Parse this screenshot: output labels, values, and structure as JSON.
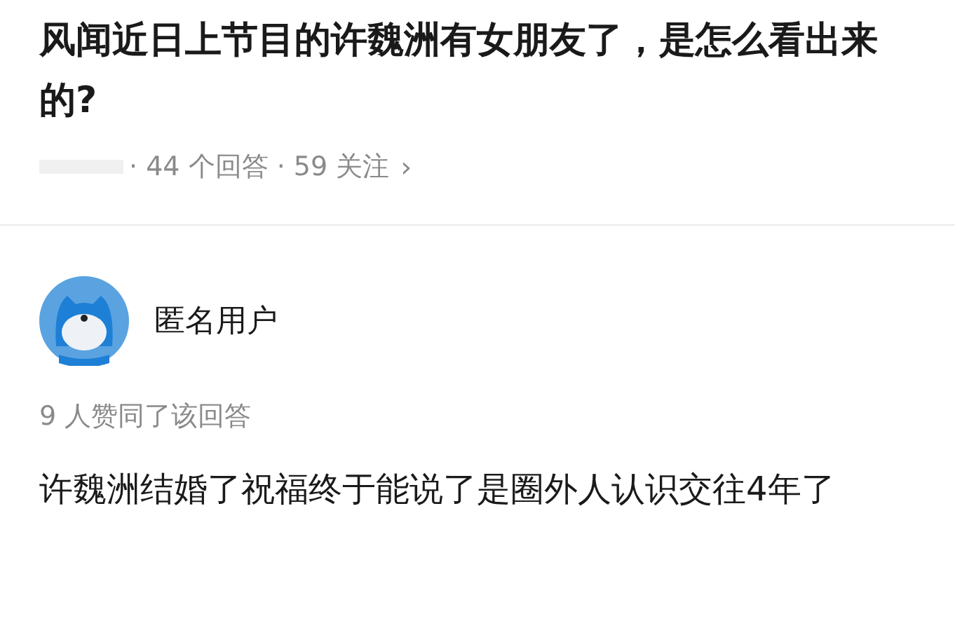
{
  "question": {
    "title": "风闻近日上节目的许魏洲有女朋友了，是怎么看出来的?",
    "stats": "· 44 个回答 · 59 关注",
    "chevron": "›"
  },
  "answer": {
    "author": "匿名用户",
    "upvotes": "9 人赞同了该回答",
    "content": "许魏洲结婚了祝福终于能说了是圈外人认识交往4年了"
  }
}
